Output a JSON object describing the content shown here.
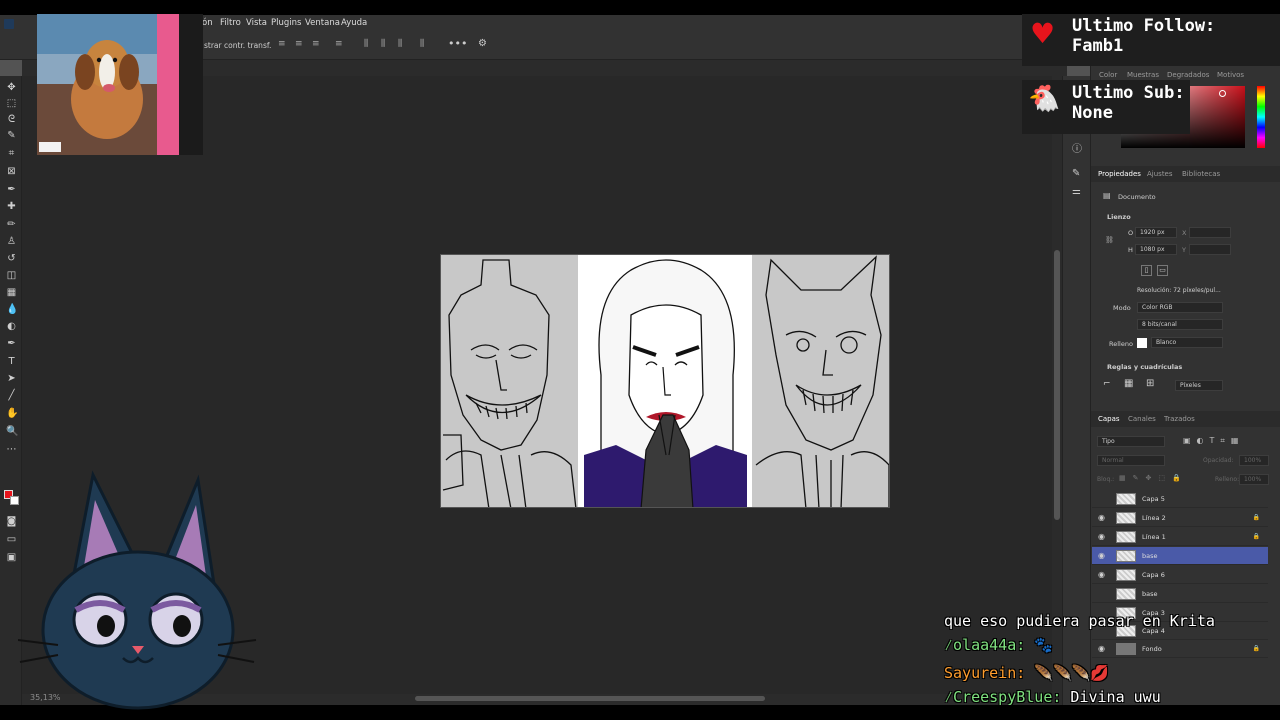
{
  "menu": {
    "partial_left": "ón",
    "items": [
      "Filtro",
      "Vista",
      "Plugins",
      "Ventana",
      "Ayuda"
    ]
  },
  "options_bar": {
    "partial_label": "strar contr. transf."
  },
  "properties_panel": {
    "tabs": [
      "Propiedades",
      "Ajustes",
      "Bibliotecas"
    ],
    "section_doc": "Documento",
    "section_lienzo": "Lienzo",
    "width_label": "O",
    "width_value": "1920 px",
    "height_label": "H",
    "height_value": "1080 px",
    "x_label": "X",
    "y_label": "Y",
    "resolution": "Resolución: 72 píxeles/pul...",
    "mode_label": "Modo",
    "mode_value": "Color RGB",
    "bits_value": "8 bits/canal",
    "fill_label": "Relleno",
    "fill_value": "Blanco",
    "section_rulers": "Reglas y cuadrículas",
    "units_value": "Píxeles"
  },
  "color_panel": {
    "tabs": [
      "Color",
      "Muestras",
      "Degradados",
      "Motivos"
    ]
  },
  "layers_panel": {
    "tabs": [
      "Capas",
      "Canales",
      "Trazados"
    ],
    "filter_value": "Tipo",
    "blend_mode": "Normal",
    "opacity_label": "Opacidad:",
    "opacity_value": "100%",
    "lock_label": "Bloq.:",
    "fill_label": "Relleno:",
    "fill_value": "100%",
    "layers": [
      {
        "name": "Capa 5",
        "visible": false,
        "locked": false,
        "selected": false
      },
      {
        "name": "Línea 2",
        "visible": true,
        "locked": true,
        "selected": false
      },
      {
        "name": "Línea 1",
        "visible": true,
        "locked": true,
        "selected": false
      },
      {
        "name": "base",
        "visible": true,
        "locked": false,
        "selected": true
      },
      {
        "name": "Capa 6",
        "visible": true,
        "locked": false,
        "selected": false
      },
      {
        "name": "base",
        "visible": false,
        "locked": false,
        "selected": false
      },
      {
        "name": "Capa 3",
        "visible": false,
        "locked": false,
        "selected": false
      },
      {
        "name": "Capa 4",
        "visible": false,
        "locked": false,
        "selected": false
      },
      {
        "name": "Fondo",
        "visible": true,
        "locked": true,
        "selected": false
      }
    ]
  },
  "status": {
    "zoom": "35,13%"
  },
  "overlay": {
    "last_follow_label": "Ultimo Follow:",
    "last_follow_value": "Famb1",
    "last_sub_label": "Ultimo Sub:",
    "last_sub_value": "None"
  },
  "chat": [
    {
      "user": "",
      "message": "que eso pudiera pasar en Krita"
    },
    {
      "user": "olaa44a:",
      "message": ""
    },
    {
      "user": "Sayurein:",
      "message": ""
    },
    {
      "user": "CreespyBlue:",
      "message": "Divina uwu"
    }
  ],
  "colors": {
    "foreground": "#e8141c",
    "background": "#ffffff",
    "selected_layer": "#4a5aa8",
    "follow_text": "#ffffff"
  }
}
